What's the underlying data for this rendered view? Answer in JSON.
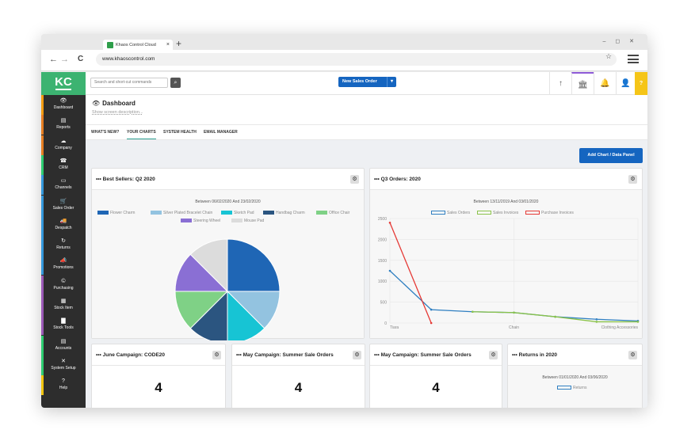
{
  "browser": {
    "tab_title": "Khaos Control Cloud",
    "tab_close": "×",
    "new_tab": "+",
    "window_controls": "–  ◻ ✕",
    "url": "www.khaoscontrol.com",
    "back": "←",
    "forward": "→",
    "reload": "C",
    "bookmark": "☆"
  },
  "app": {
    "logo": "KC",
    "search_placeholder": "Search and short-cut commands",
    "search_button": "⌕",
    "new_sales_order": "New Sales Order",
    "new_sales_order_dd": "▾",
    "top_icons": [
      "↑",
      "🏛",
      "🔔",
      "👤"
    ],
    "help": "?"
  },
  "sidebar": {
    "items": [
      {
        "label": "Dashboard",
        "icon": "👁",
        "color": "#f39c12"
      },
      {
        "label": "Reports",
        "icon": "▤",
        "color": "#e67e22"
      },
      {
        "label": "Company",
        "icon": "☁",
        "color": "#e67e22"
      },
      {
        "label": "CRM",
        "icon": "☎",
        "color": "#2ecc71"
      },
      {
        "label": "Channels",
        "icon": "▭",
        "color": "#3498db"
      },
      {
        "label": "Sales Order",
        "icon": "🛒",
        "color": "#3498db"
      },
      {
        "label": "Despatch",
        "icon": "🚚",
        "color": "#3498db"
      },
      {
        "label": "Returns",
        "icon": "↻",
        "color": "#3498db"
      },
      {
        "label": "Promotions",
        "icon": "📣",
        "color": "#3498db"
      },
      {
        "label": "Purchasing",
        "icon": "©",
        "color": "#9b59b6"
      },
      {
        "label": "Stock Item",
        "icon": "▦",
        "color": "#9b59b6"
      },
      {
        "label": "Stock Tools",
        "icon": "▇",
        "color": "#9b59b6"
      },
      {
        "label": "Accounts",
        "icon": "▤",
        "color": "#2ecc71"
      },
      {
        "label": "System Setup",
        "icon": "✕",
        "color": "#2ecc71"
      },
      {
        "label": "Help",
        "icon": "?",
        "color": "#f1c40f"
      }
    ]
  },
  "page": {
    "title": "Dashboard",
    "title_icon": "👁",
    "description": "Show screen description...",
    "tabs": [
      "WHAT'S NEW?",
      "YOUR CHARTS",
      "SYSTEM HEALTH",
      "EMAIL MANAGER"
    ],
    "add_chart": "Add Chart / Data Panel"
  },
  "panels": {
    "bestsellers": {
      "title": "Best Sellers: Q2 2020",
      "dots": "•••",
      "gear": "⚙",
      "subtitle": "Between 06/02/2020 And 23/02/2020"
    },
    "q3orders": {
      "title": "Q3 Orders: 2020",
      "dots": "•••",
      "gear": "⚙",
      "subtitle": "Between 13/11/2019 And 03/01/2020"
    },
    "june": {
      "title": "June Campaign: CODE20",
      "dots": "•••",
      "gear": "⚙",
      "value": "4"
    },
    "may1": {
      "title": "May Campaign: Summer Sale Orders",
      "dots": "•••",
      "gear": "⚙",
      "value": "4"
    },
    "may2": {
      "title": "May Campaign: Summer Sale Orders",
      "dots": "•••",
      "gear": "⚙",
      "value": "4"
    },
    "returns": {
      "title": "Returns in 2020",
      "dots": "•••",
      "gear": "⚙",
      "subtitle": "Between 01/01/2020 And 03/06/2020",
      "legend": "Returns"
    }
  },
  "chart_data": [
    {
      "type": "pie",
      "title": "Best Sellers: Q2 2020",
      "subtitle": "Between 06/02/2020 And 23/02/2020",
      "legend": "top",
      "slices": [
        {
          "name": "Flower Charm",
          "value": 25,
          "color": "#1f66b5"
        },
        {
          "name": "Silver Plated Bracelet Chain",
          "value": 12.5,
          "color": "#93c3e0"
        },
        {
          "name": "Sketch Pad",
          "value": 12.5,
          "color": "#17c4d4"
        },
        {
          "name": "Handbag Charm",
          "value": 12.5,
          "color": "#2b5580"
        },
        {
          "name": "Office Chair",
          "value": 12.5,
          "color": "#7fd186"
        },
        {
          "name": "Steering Wheel",
          "value": 12.5,
          "color": "#8a6fd4"
        },
        {
          "name": "Mouse Pad",
          "value": 12.5,
          "color": "#dcdcdc"
        }
      ]
    },
    {
      "type": "line",
      "title": "Q3 Orders: 2020",
      "subtitle": "Between 13/11/2019 And 03/01/2020",
      "legend": "top",
      "categories": [
        "Tiara",
        "Chain",
        "Clothing Accessories"
      ],
      "x": [
        0,
        1,
        2,
        3,
        4,
        5,
        6
      ],
      "ylim": [
        0,
        2500
      ],
      "yticks": [
        0,
        500,
        1000,
        1500,
        2000,
        2500
      ],
      "grid": true,
      "series": [
        {
          "name": "Sales Orders",
          "color": "#2f7fc1",
          "values": [
            1250,
            320,
            270,
            250,
            150,
            90,
            50
          ]
        },
        {
          "name": "Sales Invoices",
          "color": "#8bc34a",
          "values": [
            null,
            null,
            270,
            250,
            150,
            30,
            30
          ]
        },
        {
          "name": "Purchase Invoices",
          "color": "#e53935",
          "values": [
            2400,
            0,
            null,
            null,
            null,
            null,
            null
          ]
        }
      ]
    }
  ]
}
